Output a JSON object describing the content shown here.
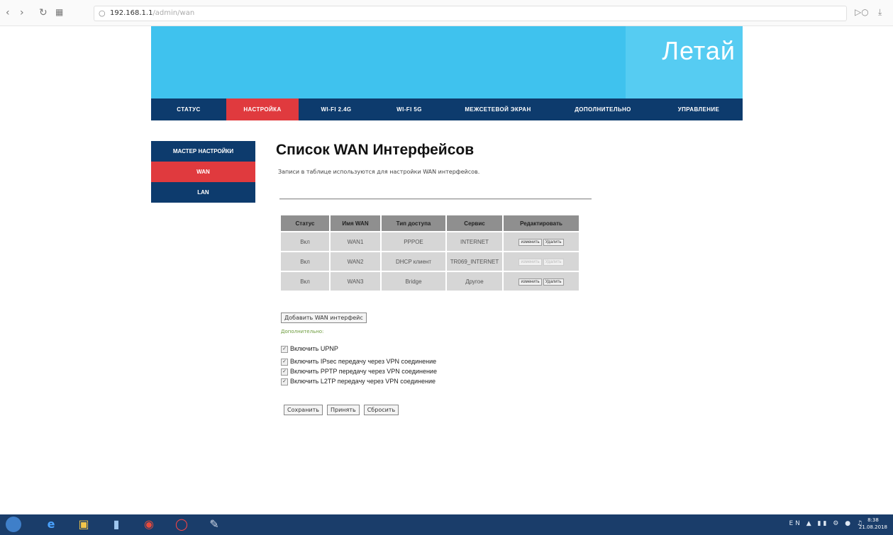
{
  "browser": {
    "back_icon": "back-arrow-icon",
    "url_host": "192.168.1.1",
    "url_path": "/admin/wan"
  },
  "header": {
    "logo": "Летай",
    "brand_color": "#3fc2ee",
    "nav_color": "#0d3b6d",
    "accent_color": "#e03a3e",
    "nav": [
      "СТАТУС",
      "НАСТРОЙКА",
      "WI-FI 2.4G",
      "WI-FI 5G",
      "МЕЖСЕТЕВОЙ ЭКРАН",
      "ДОПОЛНИТЕЛЬНО",
      "УПРАВЛЕНИЕ"
    ]
  },
  "sidebar": {
    "items": [
      "МАСТЕР НАСТРОЙКИ",
      "WAN",
      "LAN"
    ]
  },
  "main": {
    "title": "Список WAN Интерфейсов",
    "description": "Записи в таблице используются для настройки WAN интерфейсов.",
    "table": {
      "headers": [
        "Статус",
        "Имя WAN",
        "Тип доступа",
        "Сервис",
        "Редактировать"
      ],
      "rows": [
        {
          "status": "Вкл",
          "name": "WAN1",
          "type": "PPPOE",
          "service": "INTERNET",
          "edit": "изменить",
          "delete": "Удалить",
          "disabled": false
        },
        {
          "status": "Вкл",
          "name": "WAN2",
          "type": "DHCP клиент",
          "service": "TR069_INTERNET",
          "edit": "изменить",
          "delete": "Удалить",
          "disabled": true
        },
        {
          "status": "Вкл",
          "name": "WAN3",
          "type": "Bridge",
          "service": "Другое",
          "edit": "изменить",
          "delete": "Удалить",
          "disabled": false
        }
      ]
    },
    "add_button": "Добавить WAN интерфейс",
    "extra_label": "Дополнительно:",
    "checkboxes": [
      "Включить UPNP",
      "Включить IPsec передачу через VPN соединение",
      "Включить PPTP передачу через VPN соединение",
      "Включить L2TP передачу через VPN соединение"
    ],
    "buttons": [
      "Сохранить",
      "Принять",
      "Сбросить"
    ]
  },
  "taskbar": {
    "time": "8:38",
    "date": "21.08.2018"
  }
}
